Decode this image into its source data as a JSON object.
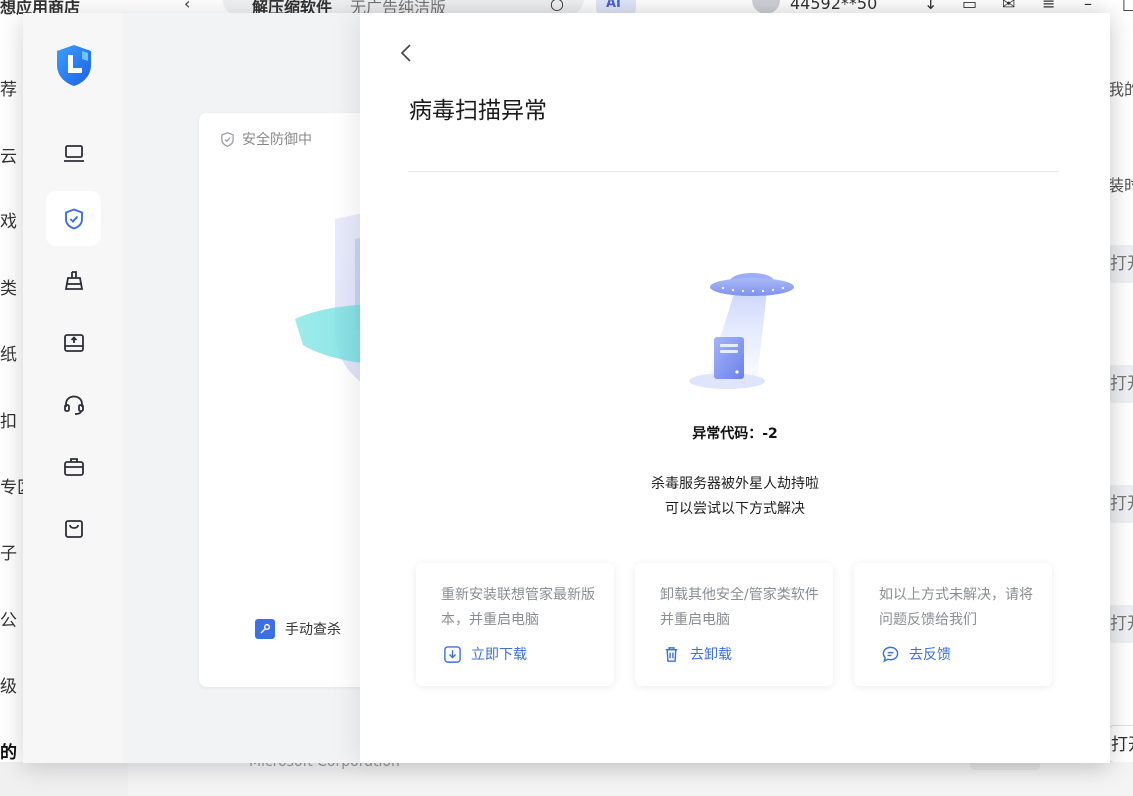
{
  "background_app": {
    "title": "想应用商店",
    "back_glyph": "‹",
    "search_text_a": "解压缩软件",
    "search_text_b": "无广告纯洁版",
    "ai_badge": "AI",
    "username": "44592**50",
    "left_nav": [
      "荐",
      "云",
      "戏",
      "类",
      "纸",
      "扣",
      "专区",
      "子",
      "公",
      "级",
      "的"
    ],
    "right_texts": [
      "我的",
      "装时"
    ],
    "open_label": "打开",
    "publisher": "Microsoft Corporation"
  },
  "security_app": {
    "status_label": "安全防御中",
    "manual_scan_label": "手动查杀",
    "sidebar_icons": [
      "laptop-icon",
      "shield-check-icon",
      "broom-icon",
      "drive-upload-icon",
      "headset-icon",
      "toolbox-icon",
      "bag-icon"
    ]
  },
  "error_panel": {
    "title": "病毒扫描异常",
    "code_line": "异常代码：-2",
    "message_line1": "杀毒服务器被外星人劫持啦",
    "message_line2": "可以尝试以下方式解决",
    "solutions": [
      {
        "description": "重新安装联想管家最新版本，并重启电脑",
        "action": "立即下载",
        "icon": "download-icon"
      },
      {
        "description": "卸载其他安全/管家类软件并重启电脑",
        "action": "去卸载",
        "icon": "trash-icon"
      },
      {
        "description": "如以上方式未解决，请将问题反馈给我们",
        "action": "去反馈",
        "icon": "chat-icon"
      }
    ]
  },
  "colors": {
    "accent": "#3d6fe0",
    "panel_bg": "#ffffff",
    "muted_text": "#8a8d93"
  }
}
